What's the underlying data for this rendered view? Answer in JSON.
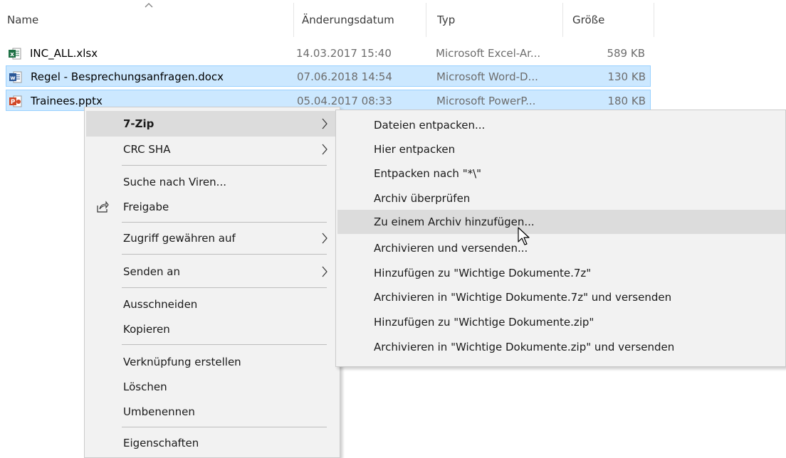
{
  "columns": {
    "name": "Name",
    "date": "Änderungsdatum",
    "type": "Typ",
    "size": "Größe"
  },
  "files": [
    {
      "name": "INC_ALL.xlsx",
      "date": "14.03.2017 15:40",
      "type": "Microsoft Excel-Ar...",
      "size": "589 KB",
      "icon": "excel-icon",
      "icon_color": "#1e7145",
      "selected": false
    },
    {
      "name": "Regel - Besprechungsanfragen.docx",
      "date": "07.06.2018 14:54",
      "type": "Microsoft Word-D...",
      "size": "130 KB",
      "icon": "word-icon",
      "icon_color": "#2b5797",
      "selected": true
    },
    {
      "name": "Trainees.pptx",
      "date": "05.04.2017 08:33",
      "type": "Microsoft PowerP...",
      "size": "180 KB",
      "icon": "powerpoint-icon",
      "icon_color": "#d24726",
      "selected": true
    }
  ],
  "context_menu": {
    "items": [
      {
        "label": "7-Zip",
        "has_submenu": true
      },
      {
        "label": "CRC SHA",
        "has_submenu": true
      },
      {
        "label": "Suche nach Viren...",
        "has_submenu": false
      },
      {
        "label": "Freigabe",
        "has_submenu": false,
        "icon": "share-icon"
      },
      {
        "label": "Zugriff gewähren auf",
        "has_submenu": true
      },
      {
        "label": "Senden an",
        "has_submenu": true
      },
      {
        "label": "Ausschneiden",
        "has_submenu": false
      },
      {
        "label": "Kopieren",
        "has_submenu": false
      },
      {
        "label": "Verknüpfung erstellen",
        "has_submenu": false
      },
      {
        "label": "Löschen",
        "has_submenu": false
      },
      {
        "label": "Umbenennen",
        "has_submenu": false
      },
      {
        "label": "Eigenschaften",
        "has_submenu": false
      }
    ]
  },
  "submenu_7zip": {
    "items": [
      "Dateien entpacken...",
      "Hier entpacken",
      "Entpacken nach \"*\\\"",
      "Archiv überprüfen",
      "Zu einem Archiv hinzufügen...",
      "Archivieren und versenden...",
      "Hinzufügen zu \"Wichtige Dokumente.7z\"",
      "Archivieren in \"Wichtige Dokumente.7z\" und versenden",
      "Hinzufügen zu \"Wichtige Dokumente.zip\"",
      "Archivieren in \"Wichtige Dokumente.zip\" und versenden"
    ],
    "hovered_index": 4
  },
  "colors": {
    "selection_bg": "#cce8ff",
    "selection_border": "#99d1ff",
    "menu_bg": "#f2f2f2",
    "menu_hover": "#dcdcdc"
  }
}
